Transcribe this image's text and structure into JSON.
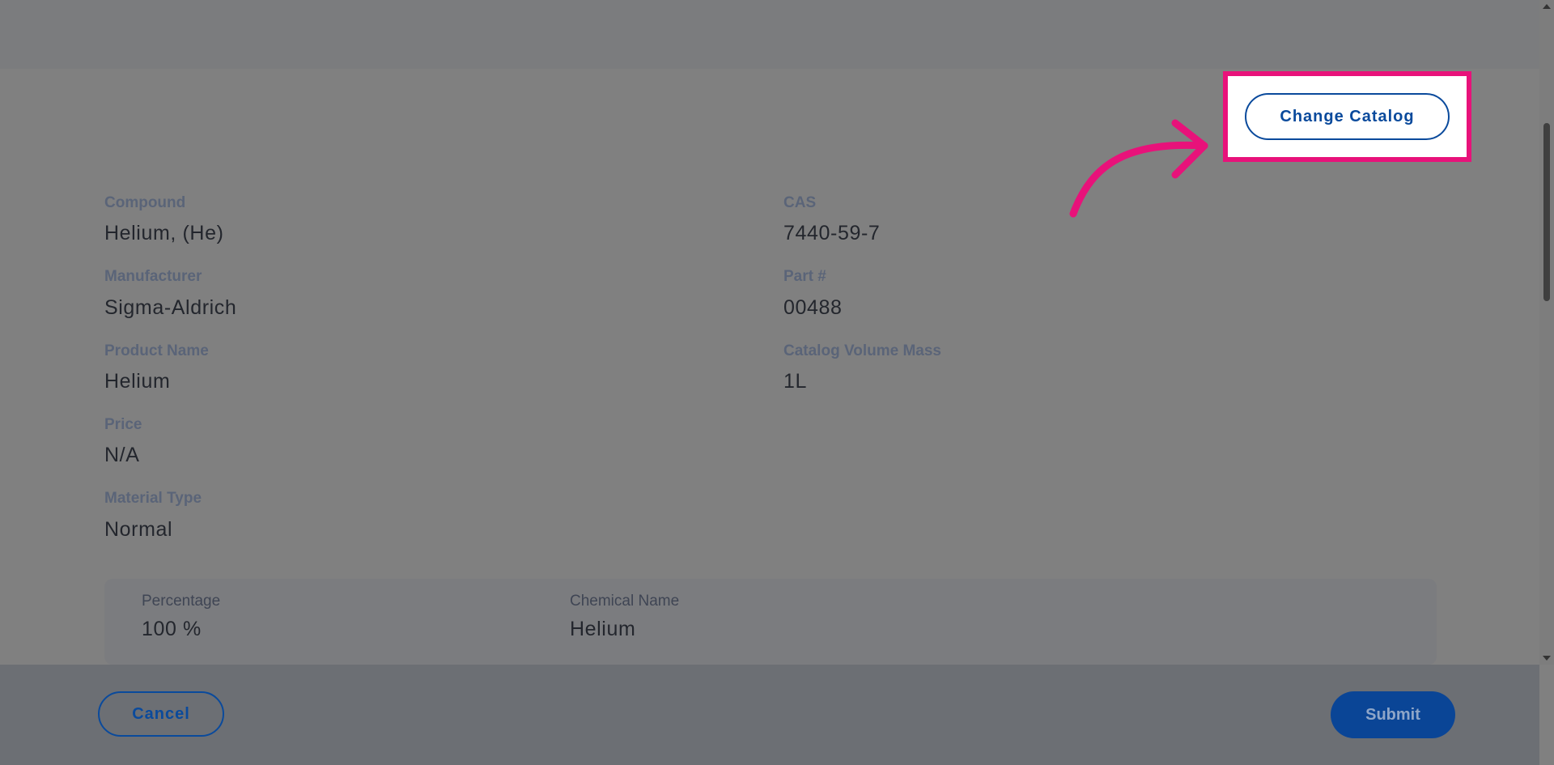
{
  "actions": {
    "change_catalog_label": "Change Catalog",
    "cancel_label": "Cancel",
    "submit_label": "Submit"
  },
  "details": {
    "compound": {
      "label": "Compound",
      "value": "Helium, (He)"
    },
    "cas": {
      "label": "CAS",
      "value": "7440-59-7"
    },
    "manufacturer": {
      "label": "Manufacturer",
      "value": "Sigma-Aldrich"
    },
    "part_number": {
      "label": "Part #",
      "value": "00488"
    },
    "product_name": {
      "label": "Product Name",
      "value": "Helium"
    },
    "catalog_volume_mass": {
      "label": "Catalog Volume Mass",
      "value": "1L"
    },
    "price": {
      "label": "Price",
      "value": "N/A"
    },
    "material_type": {
      "label": "Material Type",
      "value": "Normal"
    }
  },
  "composition": {
    "percentage": {
      "label": "Percentage",
      "value": "100 %"
    },
    "chemical_name": {
      "label": "Chemical Name",
      "value": "Helium"
    }
  },
  "colors": {
    "highlight": "#e8127a",
    "primary": "#0a4a9c",
    "overlay": "#808080"
  },
  "icons": {
    "annotation_arrow": "curved-arrow-icon"
  }
}
